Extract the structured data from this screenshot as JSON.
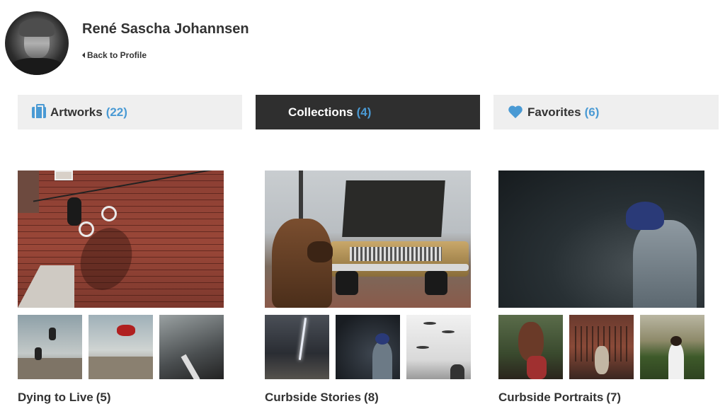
{
  "profile": {
    "name": "René Sascha Johannsen",
    "back_label": "Back to Profile"
  },
  "tabs": [
    {
      "label": "Artworks",
      "count": "(22)",
      "icon": "briefcase-icon",
      "active": false
    },
    {
      "label": "Collections",
      "count": "(4)",
      "icon": "grid-icon",
      "active": true
    },
    {
      "label": "Favorites",
      "count": "(6)",
      "icon": "heart-icon",
      "active": false
    }
  ],
  "collections": [
    {
      "title": "Dying to Live",
      "count": "(5)"
    },
    {
      "title": "Curbside Stories",
      "count": "(8)"
    },
    {
      "title": "Curbside Portraits",
      "count": "(7)"
    }
  ],
  "colors": {
    "accent": "#4a9ad4",
    "active_tab_bg": "#2f2f2f",
    "tab_bg": "#efefef"
  }
}
